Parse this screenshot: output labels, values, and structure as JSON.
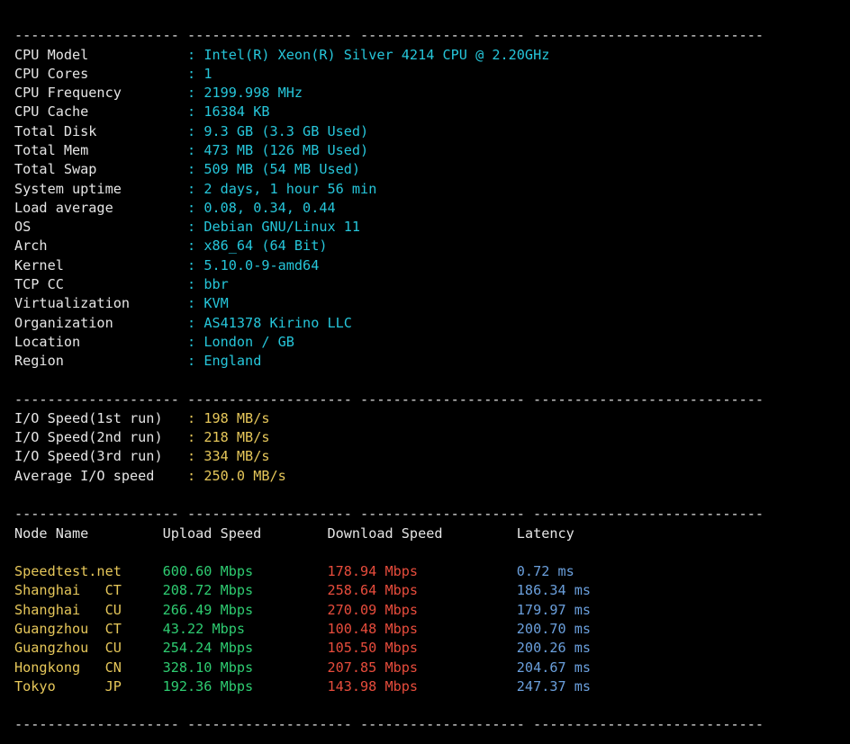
{
  "sys": [
    {
      "k": "CPU Model",
      "v": "Intel(R) Xeon(R) Silver 4214 CPU @ 2.20GHz"
    },
    {
      "k": "CPU Cores",
      "v": "1"
    },
    {
      "k": "CPU Frequency",
      "v": "2199.998 MHz"
    },
    {
      "k": "CPU Cache",
      "v": "16384 KB"
    },
    {
      "k": "Total Disk",
      "v": "9.3 GB (3.3 GB Used)"
    },
    {
      "k": "Total Mem",
      "v": "473 MB (126 MB Used)"
    },
    {
      "k": "Total Swap",
      "v": "509 MB (54 MB Used)"
    },
    {
      "k": "System uptime",
      "v": "2 days, 1 hour 56 min"
    },
    {
      "k": "Load average",
      "v": "0.08, 0.34, 0.44"
    },
    {
      "k": "OS",
      "v": "Debian GNU/Linux 11"
    },
    {
      "k": "Arch",
      "v": "x86_64 (64 Bit)"
    },
    {
      "k": "Kernel",
      "v": "5.10.0-9-amd64"
    },
    {
      "k": "TCP CC",
      "v": "bbr"
    },
    {
      "k": "Virtualization",
      "v": "KVM"
    },
    {
      "k": "Organization",
      "v": "AS41378 Kirino LLC"
    },
    {
      "k": "Location",
      "v": "London / GB"
    },
    {
      "k": "Region",
      "v": "England"
    }
  ],
  "io": [
    {
      "k": "I/O Speed(1st run)",
      "v": "198 MB/s"
    },
    {
      "k": "I/O Speed(2nd run)",
      "v": "218 MB/s"
    },
    {
      "k": "I/O Speed(3rd run)",
      "v": "334 MB/s"
    },
    {
      "k": "Average I/O speed",
      "v": "250.0 MB/s"
    }
  ],
  "speed_header": {
    "node": "Node Name",
    "up": "Upload Speed",
    "down": "Download Speed",
    "lat": "Latency"
  },
  "speed": [
    {
      "node": "Speedtest.net",
      "up": "600.60 Mbps",
      "down": "178.94 Mbps",
      "lat": "0.72 ms"
    },
    {
      "node": "Shanghai   CT",
      "up": "208.72 Mbps",
      "down": "258.64 Mbps",
      "lat": "186.34 ms"
    },
    {
      "node": "Shanghai   CU",
      "up": "266.49 Mbps",
      "down": "270.09 Mbps",
      "lat": "179.97 ms"
    },
    {
      "node": "Guangzhou  CT",
      "up": "43.22 Mbps",
      "down": "100.48 Mbps",
      "lat": "200.70 ms"
    },
    {
      "node": "Guangzhou  CU",
      "up": "254.24 Mbps",
      "down": "105.50 Mbps",
      "lat": "200.26 ms"
    },
    {
      "node": "Hongkong   CN",
      "up": "328.10 Mbps",
      "down": "207.85 Mbps",
      "lat": "204.67 ms"
    },
    {
      "node": "Tokyo      JP",
      "up": "192.36 Mbps",
      "down": "143.98 Mbps",
      "lat": "247.37 ms"
    }
  ]
}
